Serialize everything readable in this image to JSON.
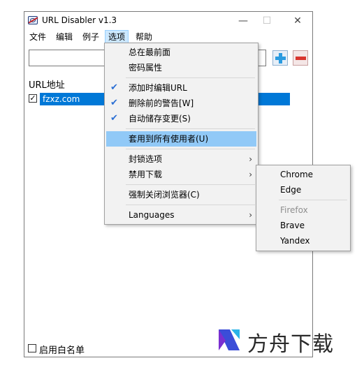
{
  "window": {
    "title": "URL Disabler v1.3",
    "controls": {
      "minimize": "—",
      "maximize": "☐",
      "close": "✕"
    }
  },
  "menubar": {
    "items": [
      "文件",
      "编辑",
      "例子",
      "选项",
      "帮助"
    ],
    "active": "选项"
  },
  "toolbar": {
    "url_value": "",
    "add_icon": "plus-icon",
    "remove_icon": "minus-icon"
  },
  "list": {
    "header": "URL地址",
    "rows": [
      {
        "checked": true,
        "url": "fzxz.com",
        "selected": true
      }
    ]
  },
  "options_menu": {
    "items": [
      {
        "label": "总在最前面",
        "checked": false
      },
      {
        "label": "密码属性",
        "checked": false
      },
      {
        "label": "添加时编辑URL",
        "checked": true
      },
      {
        "label": "删除前的警告[W]",
        "checked": true
      },
      {
        "label": "自动储存变更(S)",
        "checked": true
      },
      {
        "label": "套用到所有使用者(U)",
        "highlighted": true
      },
      {
        "label": "封锁选项",
        "submenu": true
      },
      {
        "label": "禁用下载",
        "submenu": true
      },
      {
        "label": "强制关闭浏览器(C)"
      },
      {
        "label": "Languages",
        "submenu": true
      }
    ]
  },
  "download_submenu": {
    "items": [
      {
        "label": "Chrome",
        "disabled": false
      },
      {
        "label": "Edge",
        "disabled": false
      },
      {
        "label": "Firefox",
        "disabled": true
      },
      {
        "label": "Brave",
        "disabled": false
      },
      {
        "label": "Yandex",
        "disabled": false
      }
    ]
  },
  "status": {
    "whitelist_label": "启用白名单",
    "whitelist_checked": false
  },
  "watermark": {
    "text": "方舟下载"
  },
  "colors": {
    "selection": "#0078d7",
    "menu_highlight": "#91c9f7",
    "add": "#2a9be0",
    "remove": "#d8352e"
  }
}
